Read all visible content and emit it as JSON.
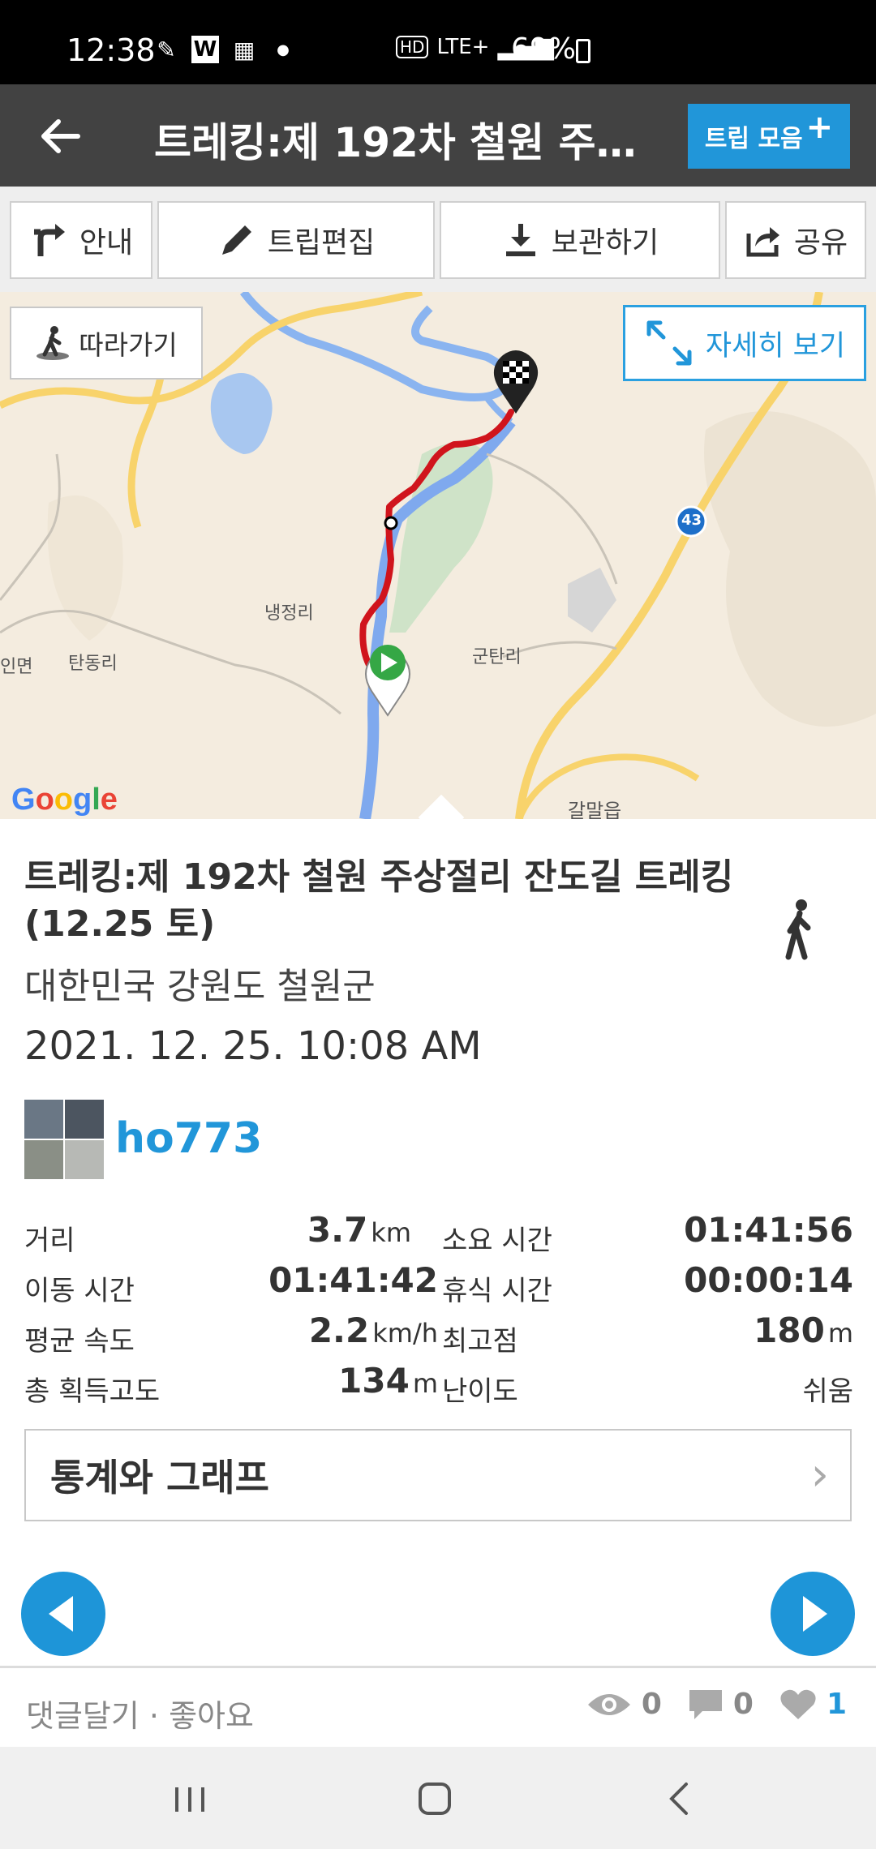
{
  "status_bar": {
    "time": "12:38",
    "network": "LTE+",
    "battery": "69%"
  },
  "app_bar": {
    "title": "트레킹:제 192차 철원 주상...",
    "trip_collect_label": "트립 모음",
    "trip_collect_plus": "+"
  },
  "toolbar": {
    "guide": "안내",
    "edit": "트립편집",
    "save": "보관하기",
    "share": "공유"
  },
  "map": {
    "follow_label": "따라가기",
    "detail_label": "자세히 보기",
    "labels": {
      "naengjeong": "냉정리",
      "guntan": "군탄리",
      "tandong": "탄동리",
      "inmyeon": "인면",
      "galmal": "갈말읍",
      "route43": "43"
    },
    "google": "Google"
  },
  "trip": {
    "title": "트레킹:제 192차 철원 주상절리 잔도길 트레킹(12.25 토)",
    "location": "대한민국 강원도 철원군",
    "date": "2021. 12. 25. 10:08 AM",
    "user": "ho773"
  },
  "stats": [
    {
      "label": "거리",
      "value": "3.7",
      "unit": "km",
      "label2": "소요 시간",
      "value2": "01:41:56",
      "unit2": ""
    },
    {
      "label": "이동 시간",
      "value": "01:41:42",
      "unit": "",
      "label2": "휴식 시간",
      "value2": "00:00:14",
      "unit2": ""
    },
    {
      "label": "평균 속도",
      "value": "2.2",
      "unit": "km/h",
      "label2": "최고점",
      "value2": "180",
      "unit2": "m"
    },
    {
      "label": "총 획득고도",
      "value": "134",
      "unit": "m",
      "label2": "난이도",
      "value2": "쉬움",
      "unit2": ""
    }
  ],
  "stats_graph_label": "통계와 그래프",
  "stats_graph_chevron": "›",
  "comment_bar": {
    "label": "댓글달기 · 좋아요",
    "views": "0",
    "comments": "0",
    "likes": "1"
  },
  "colors": {
    "accent": "#2196d9",
    "app_bar": "#424242",
    "route": "#d0141c"
  }
}
